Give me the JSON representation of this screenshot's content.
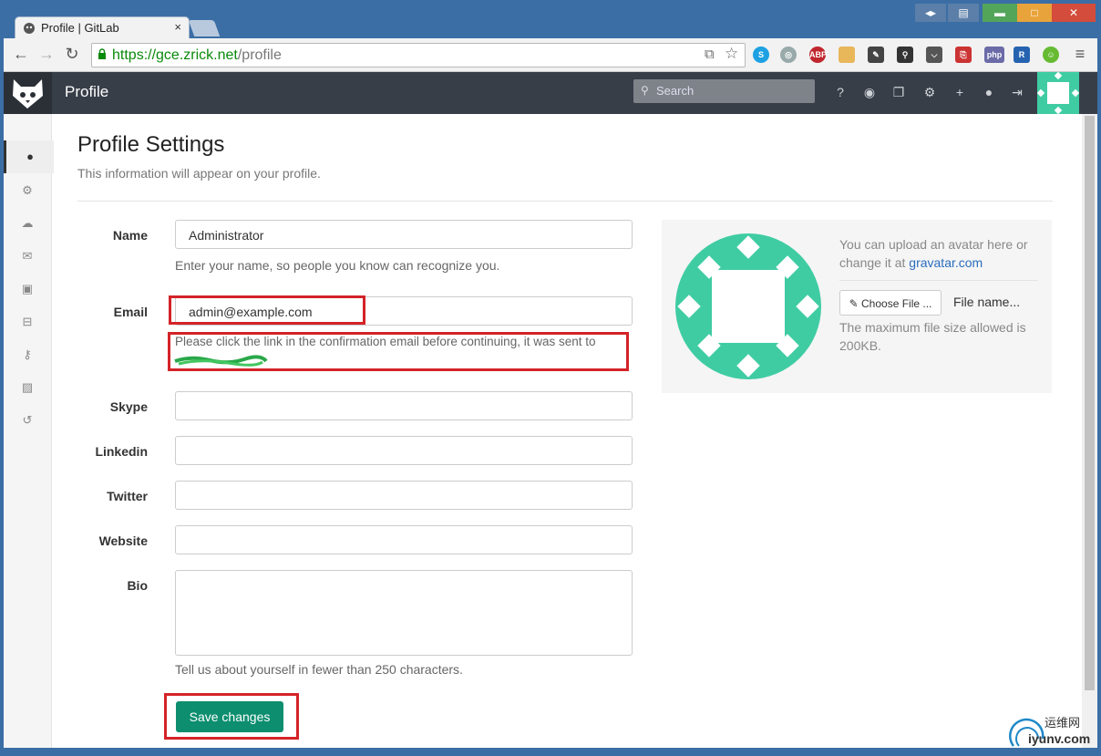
{
  "browser": {
    "tab_title": "Profile | GitLab",
    "tab_close": "×",
    "url_host": "https://gce.zrick.net",
    "url_path": "/profile"
  },
  "header": {
    "page_label": "Profile",
    "search_placeholder": "Search"
  },
  "page": {
    "title": "Profile Settings",
    "subtitle": "This information will appear on your profile."
  },
  "form": {
    "name_label": "Name",
    "name_value": "Administrator",
    "name_help": "Enter your name, so people you know can recognize you.",
    "email_label": "Email",
    "email_value": "admin@example.com",
    "email_notice": "Please click the link in the confirmation email before continuing, it was sent to",
    "skype_label": "Skype",
    "linkedin_label": "Linkedin",
    "twitter_label": "Twitter",
    "website_label": "Website",
    "bio_label": "Bio",
    "bio_help": "Tell us about yourself in fewer than 250 characters.",
    "save_label": "Save changes"
  },
  "avatar": {
    "upload_text": "You can upload an avatar here or change it at",
    "gravatar_link": "gravatar.com",
    "choose_file_label": "Choose File ...",
    "file_name": "File name...",
    "max_size_text": "The maximum file size allowed is 200KB."
  },
  "extensions": {
    "abp": "ABP",
    "php": "php"
  },
  "watermark": {
    "cn": "运维网",
    "domain": "iyunv.com"
  },
  "colors": {
    "header_bg": "#383e48",
    "save_button": "#0c8e6f",
    "avatar_teal": "#3fcca3",
    "highlight_red": "#d42328"
  }
}
